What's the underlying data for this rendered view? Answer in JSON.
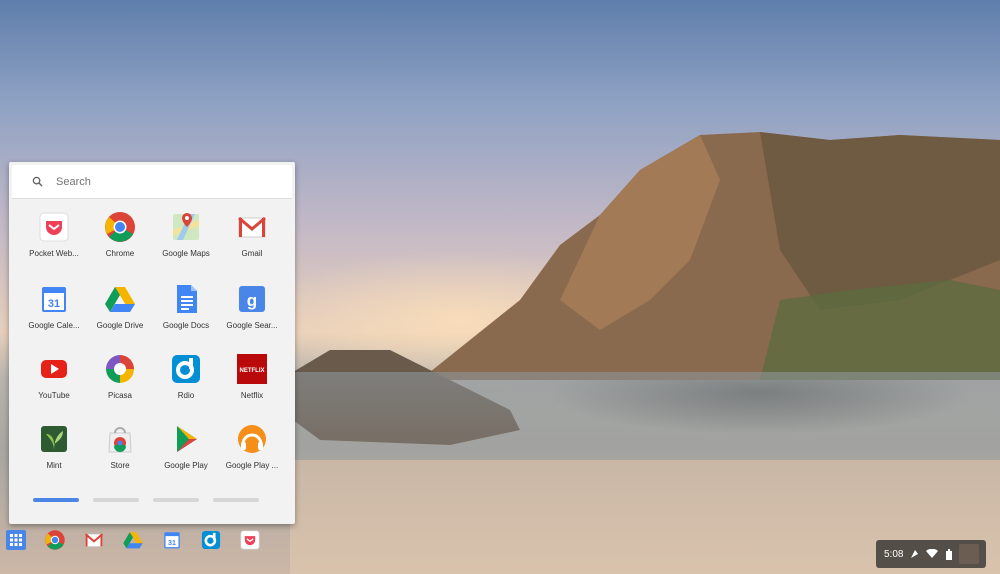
{
  "launcher": {
    "search_placeholder": "Search",
    "apps": [
      {
        "label": "Pocket Web...",
        "icon": "pocket-icon"
      },
      {
        "label": "Chrome",
        "icon": "chrome-icon"
      },
      {
        "label": "Google Maps",
        "icon": "maps-icon"
      },
      {
        "label": "Gmail",
        "icon": "gmail-icon"
      },
      {
        "label": "Google Cale...",
        "icon": "calendar-icon"
      },
      {
        "label": "Google Drive",
        "icon": "drive-icon"
      },
      {
        "label": "Google Docs",
        "icon": "docs-icon"
      },
      {
        "label": "Google Sear...",
        "icon": "search-g-icon"
      },
      {
        "label": "YouTube",
        "icon": "youtube-icon"
      },
      {
        "label": "Picasa",
        "icon": "picasa-icon"
      },
      {
        "label": "Rdio",
        "icon": "rdio-icon"
      },
      {
        "label": "Netflix",
        "icon": "netflix-icon"
      },
      {
        "label": "Mint",
        "icon": "mint-icon"
      },
      {
        "label": "Store",
        "icon": "store-icon"
      },
      {
        "label": "Google Play",
        "icon": "play-icon"
      },
      {
        "label": "Google Play ...",
        "icon": "play-music-icon"
      }
    ],
    "page_count": 4,
    "active_page": 1
  },
  "netflix_logo_text": "NETFLIX",
  "calendar_day": "31",
  "shelf": {
    "items": [
      "launcher-icon",
      "chrome-icon",
      "gmail-icon",
      "drive-icon",
      "calendar-icon",
      "rdio-icon",
      "pocket-icon"
    ]
  },
  "tray": {
    "clock": "5:08"
  },
  "colors": {
    "accent": "#4a86e8",
    "chrome_red": "#db4437",
    "chrome_green": "#0f9d58",
    "chrome_yellow": "#f4b400",
    "chrome_blue": "#4285f4"
  }
}
